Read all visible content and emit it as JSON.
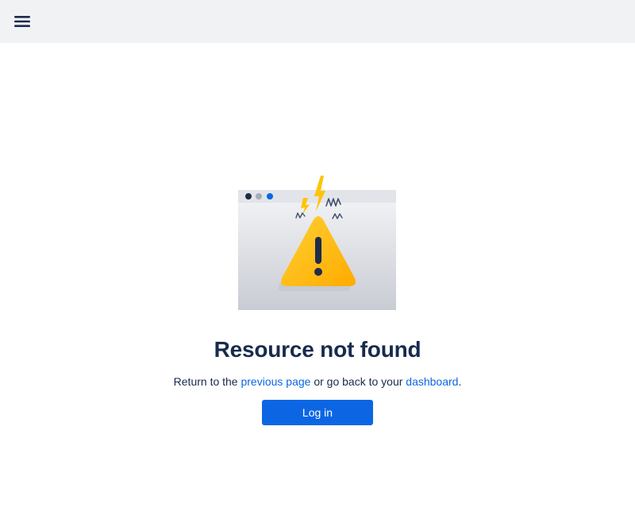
{
  "header": {
    "menu_icon": "hamburger-menu-icon"
  },
  "illustration": {
    "icon": "warning-triangle-icon",
    "dot_colors": [
      "#1e2b4a",
      "#a5adba",
      "#0c66e4"
    ],
    "accent_color": "#ffc400"
  },
  "error": {
    "title": "Resource not found",
    "message_prefix": "Return to the ",
    "previous_page_link": "previous page",
    "message_middle": " or go back to your ",
    "dashboard_link": "dashboard",
    "message_suffix": "."
  },
  "actions": {
    "login_label": "Log in"
  },
  "colors": {
    "topbar_bg": "#f1f2f4",
    "primary": "#0c66e4",
    "text": "#172b4d"
  }
}
